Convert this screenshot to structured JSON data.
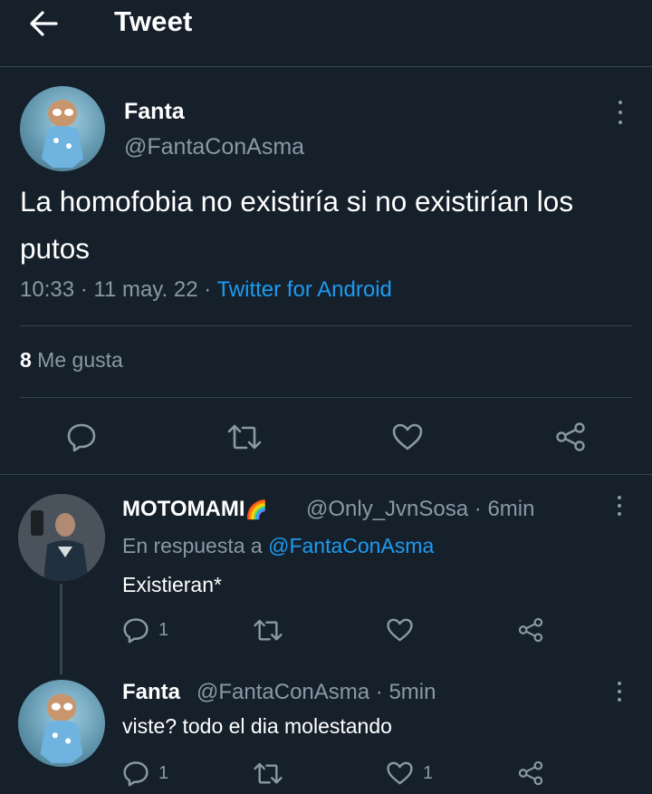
{
  "header": {
    "title": "Tweet",
    "back_icon": "arrow-left-icon"
  },
  "tweet": {
    "display_name": "Fanta",
    "handle": "@FantaConAsma",
    "text": "La homofobia no existiría si no existirían los putos",
    "time": "10:33 · 11 may. 22 · ",
    "source": "Twitter for Android",
    "likes_count": "8",
    "likes_label": " Me gusta"
  },
  "replies": [
    {
      "display_name": "MOTOMAMI",
      "emoji": "🌈",
      "handle_time": "@Only_JvnSosa · 6min",
      "in_reply_prefix": "En respuesta a ",
      "in_reply_handle": "@FantaConAsma",
      "text": "Existieran*",
      "reply_count": "1",
      "like_count": ""
    },
    {
      "display_name": "Fanta",
      "handle_time": "@FantaConAsma · 5min",
      "text": "viste? todo el dia molestando",
      "reply_count": "1",
      "like_count": "1"
    }
  ],
  "colors": {
    "background": "#15202b",
    "accent": "#1d9bf0",
    "muted": "#8b98a5",
    "divider": "#38444d"
  }
}
